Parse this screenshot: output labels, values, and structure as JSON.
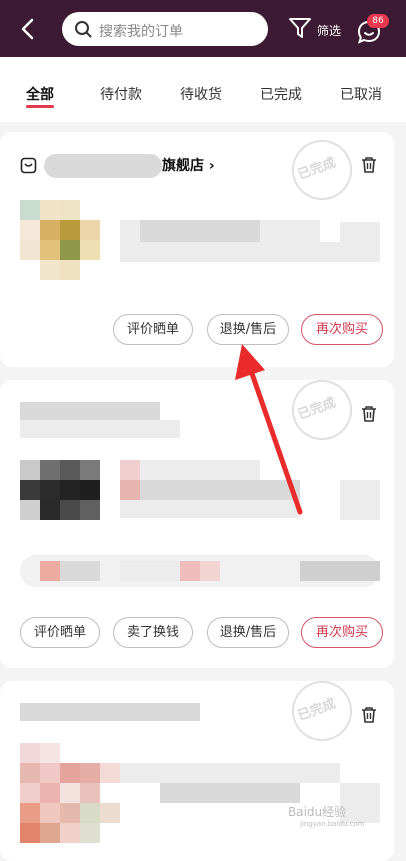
{
  "header": {
    "search_placeholder": "搜索我的订单",
    "filter_label": "筛选",
    "message_badge": "86"
  },
  "tabs": [
    {
      "label": "全部",
      "active": true
    },
    {
      "label": "待付款"
    },
    {
      "label": "待收货"
    },
    {
      "label": "已完成"
    },
    {
      "label": "已取消"
    }
  ],
  "orders": [
    {
      "store_name": "旗舰店",
      "status_stamp": "已完成",
      "buttons": [
        "评价晒单",
        "退换/售后",
        "再次购买"
      ]
    },
    {
      "status_stamp": "已完成",
      "buttons": [
        "评价晒单",
        "卖了换钱",
        "退换/售后",
        "再次购买"
      ]
    },
    {
      "status_stamp": "已完成"
    }
  ],
  "watermark": {
    "main": "Baidu经验",
    "sub": "jingyan.baidu.com"
  },
  "colors": {
    "topbar": "#3d1a33",
    "accent": "#e23b4f",
    "badge": "#e8384f"
  }
}
